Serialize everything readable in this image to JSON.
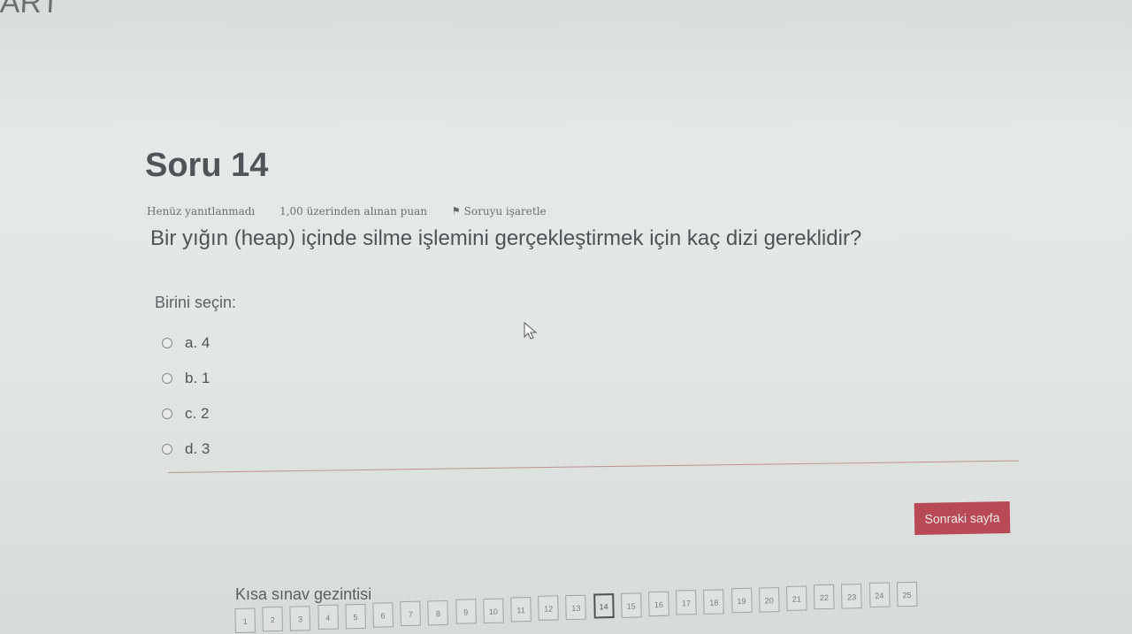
{
  "page": {
    "top_fragment": "ART"
  },
  "question": {
    "title": "Soru 14",
    "status": "Henüz yanıtlanmadı",
    "points": "1,00 üzerinden alınan puan",
    "flag_label": "Soruyu işaretle",
    "text": "Bir yığın (heap) içinde silme işlemini gerçekleştirmek için kaç dizi gereklidir?",
    "prompt": "Birini seçin:",
    "options": [
      {
        "label": "a. 4"
      },
      {
        "label": "b. 1"
      },
      {
        "label": "c. 2"
      },
      {
        "label": "d. 3"
      }
    ]
  },
  "navigation": {
    "next_label": "Sonraki sayfa",
    "title": "Kısa sınav gezintisi",
    "current": 14,
    "pages": [
      "1",
      "2",
      "3",
      "4",
      "5",
      "6",
      "7",
      "8",
      "9",
      "10",
      "11",
      "12",
      "13",
      "14",
      "15",
      "16",
      "17",
      "18",
      "19",
      "20",
      "21",
      "22",
      "23",
      "24",
      "25"
    ]
  },
  "colors": {
    "accent": "#b84a55",
    "divider": "#b88a84",
    "text": "#4d5356"
  }
}
